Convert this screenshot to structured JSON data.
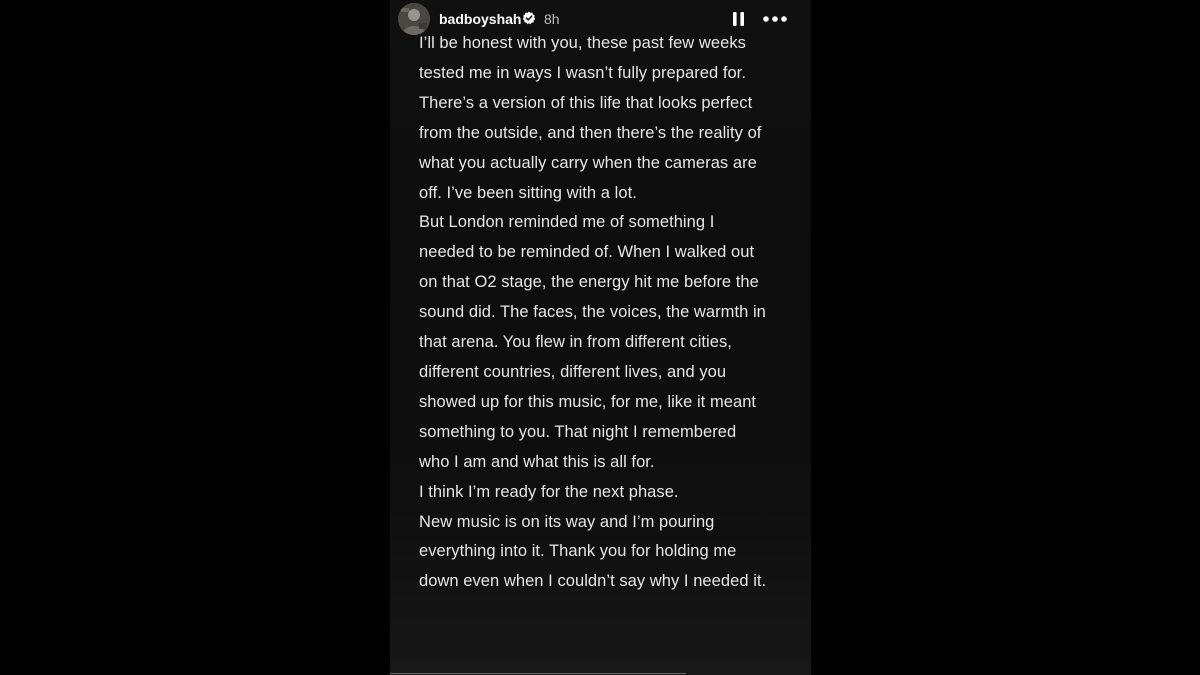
{
  "story": {
    "username": "badboyshah",
    "timestamp": "8h",
    "verified": true,
    "avatar_icon": "profile-avatar",
    "pause_icon": "pause-icon",
    "more_icon": "more-options-icon",
    "paragraphs": [
      "I’ll be honest with you, these past few weeks tested me in ways I wasn’t fully prepared for. There’s a version of this life that looks perfect from the outside, and then there’s the reality of what you actually carry when the cameras are off. I’ve been sitting with a lot.",
      "But London reminded me of something I needed to be reminded of. When I walked out on that O2 stage, the energy hit me before the sound did. The faces, the voices, the warmth in that arena. You flew in from different cities, different countries, different lives, and you showed up for this music, for me, like it meant something to you. That night I remembered who I am and what this is all for.",
      "I think I’m ready for the next phase.",
      "New music is on its way and I’m pouring everything into it. Thank you for holding me down even when I couldn’t say why I needed it."
    ]
  },
  "colors": {
    "page_background": "#000000",
    "story_background": "#0f0f0f",
    "text": "#e6e6e6",
    "username": "#ffffff",
    "verified_badge": "#ffffff"
  }
}
